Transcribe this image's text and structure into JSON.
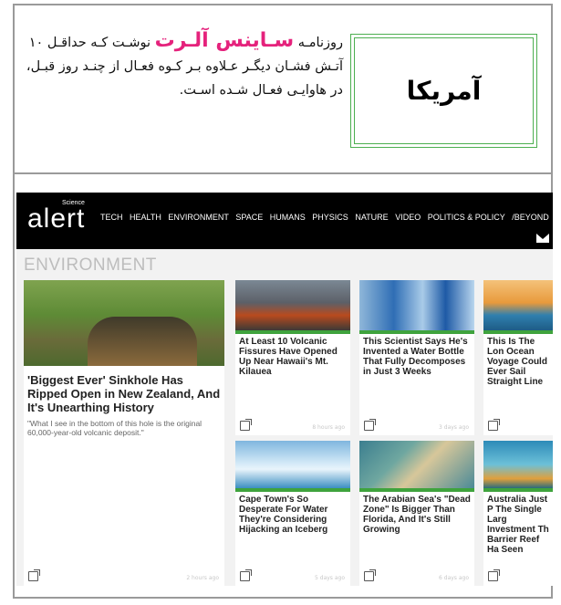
{
  "article": {
    "title": "آمریکا",
    "intro_before": "روزنامـه ",
    "intro_brand": "سـاینس آلـرت",
    "intro_after": " نوشـت کـه حداقـل ۱۰ آتـش فشـان دیگـر عـلاوه بـر کـوه فعـال از چنـد روز قبـل، در هاوایـی فعـال شـده اسـت."
  },
  "website": {
    "logo_super": "Science",
    "logo": "alert",
    "nav": [
      "TECH",
      "HEALTH",
      "ENVIRONMENT",
      "SPACE",
      "HUMANS",
      "PHYSICS",
      "NATURE",
      "VIDEO",
      "POLITICS & POLICY",
      "/BEYOND"
    ],
    "mail_icon": "mail-icon",
    "section": "ENVIRONMENT",
    "featured": {
      "title": "'Biggest Ever' Sinkhole Has Ripped Open in New Zealand, And It's Unearthing History",
      "quote": "\"What I see in the bottom of this hole is the original 60,000-year-old volcanic deposit.\"",
      "time": "2 hours ago"
    },
    "cards": [
      {
        "title": "At Least 10 Volcanic Fissures Have Opened Up Near Hawaii's Mt. Kilauea",
        "time": "8 hours ago"
      },
      {
        "title": "This Scientist Says He's Invented a Water Bottle That Fully Decomposes in Just 3 Weeks",
        "time": "3 days ago"
      },
      {
        "title": "This Is The Lon Ocean Voyage Could Ever Sail Straight Line",
        "time": ""
      },
      {
        "title": "Cape Town's So Desperate For Water They're Considering Hijacking an Iceberg",
        "time": "5 days ago"
      },
      {
        "title": "The Arabian Sea's \"Dead Zone\" Is Bigger Than Florida, And It's Still Growing",
        "time": "6 days ago"
      },
      {
        "title": "Australia Just P The Single Larg Investment Th Barrier Reef Ha Seen",
        "time": ""
      }
    ]
  },
  "colors": {
    "brand": "#e5227c",
    "green": "#3fa33d",
    "frame": "#9a9a9a"
  }
}
